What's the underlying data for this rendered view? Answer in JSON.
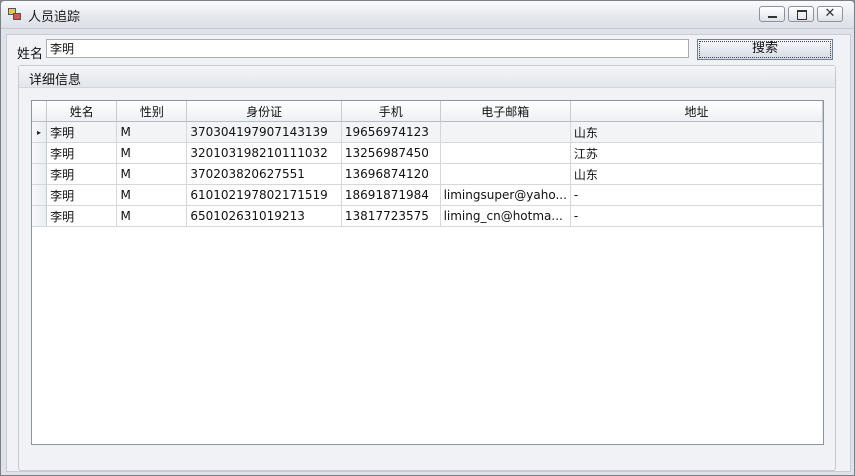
{
  "window": {
    "title": "人员追踪",
    "minimize_glyph": "",
    "close_glyph": "✕"
  },
  "search": {
    "label": "姓名",
    "value": "李明",
    "button_label": "搜索"
  },
  "details": {
    "title": "详细信息",
    "columns": [
      "姓名",
      "性别",
      "身份证",
      "手机",
      "电子邮箱",
      "地址"
    ],
    "rows": [
      {
        "current": "▸",
        "name": "李明",
        "gender": "M",
        "id": "370304197907143139",
        "phone": "19656974123",
        "email": "",
        "address": "山东"
      },
      {
        "current": "",
        "name": "李明",
        "gender": "M",
        "id": "320103198210111032",
        "phone": "13256987450",
        "email": "",
        "address": "江苏"
      },
      {
        "current": "",
        "name": "李明",
        "gender": "M",
        "id": "370203820627551",
        "phone": "13696874120",
        "email": "",
        "address": "山东"
      },
      {
        "current": "",
        "name": "李明",
        "gender": "M",
        "id": "610102197802171519",
        "phone": "18691871984",
        "email": "limingsuper@yaho...",
        "address": "-"
      },
      {
        "current": "",
        "name": "李明",
        "gender": "M",
        "id": "650102631019213",
        "phone": "13817723575",
        "email": "liming_cn@hotma...",
        "address": "-"
      }
    ]
  },
  "colors": {
    "window_bg": "#dfe3e9",
    "client_bg": "#f0f2f5",
    "grid_border": "#8e949c"
  }
}
